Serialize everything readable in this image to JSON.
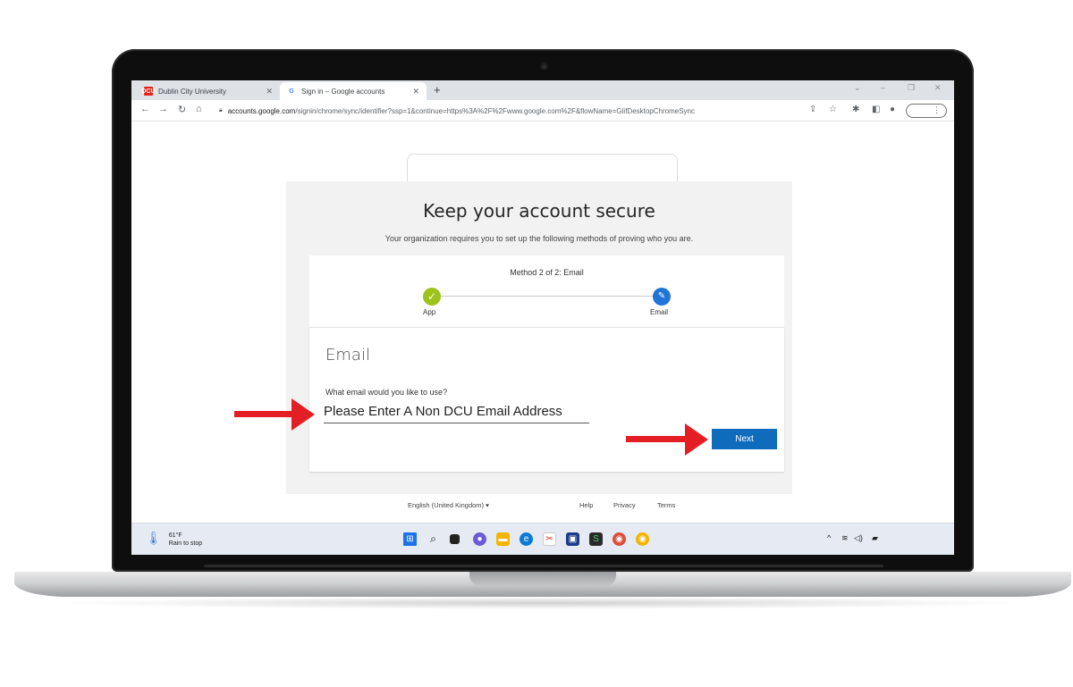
{
  "browser": {
    "tabs": [
      {
        "label": "Dublin City University",
        "favicon": "dcu-logo-icon",
        "active": false
      },
      {
        "label": "Sign in – Google accounts",
        "favicon": "google-logo-icon",
        "active": true
      }
    ],
    "url": {
      "domain": "accounts.google.com",
      "path": "/signin/chrome/sync/identifier?ssp=1&continue=https%3A%2F%2Fwww.google.com%2F&flowName=GlifDesktopChromeSync"
    }
  },
  "page": {
    "title": "Keep your account secure",
    "subtitle": "Your organization requires you to set up the following methods of proving who you are.",
    "method_label": "Method 2 of 2: Email",
    "steps": [
      {
        "label": "App",
        "state": "done",
        "color": "#9bc31b"
      },
      {
        "label": "Email",
        "state": "current",
        "color": "#1f74d6"
      }
    ],
    "section_heading": "Email",
    "question": "What email would you like to use?",
    "email_value": "Please Enter A Non DCU Email Address",
    "next_label": "Next",
    "next_color": "#0f6cbd"
  },
  "footer": {
    "language": "English (United Kingdom)",
    "help": "Help",
    "privacy": "Privacy",
    "terms": "Terms"
  },
  "taskbar": {
    "weather_temp": "61°F",
    "weather_desc": "Rain to stop"
  },
  "annotation_color": "#e31e24"
}
